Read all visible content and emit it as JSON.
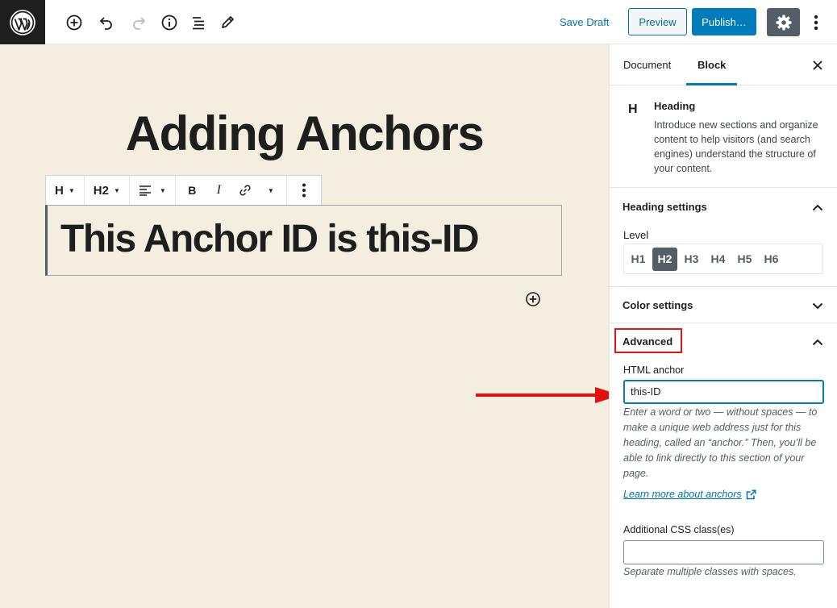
{
  "topbar": {
    "save_draft": "Save Draft",
    "preview": "Preview",
    "publish": "Publish…"
  },
  "editor": {
    "post_title": "Adding Anchors",
    "heading_text": "This Anchor ID is this-ID",
    "block_toolbar": {
      "block_type": "H",
      "heading_level": "H2",
      "bold": "B",
      "italic": "I"
    }
  },
  "sidebar": {
    "tabs": [
      {
        "label": "Document",
        "active": false
      },
      {
        "label": "Block",
        "active": true
      }
    ],
    "block_card": {
      "icon_letter": "H",
      "title": "Heading",
      "description": "Introduce new sections and organize content to help visitors (and search engines) understand the structure of your content."
    },
    "heading_settings": {
      "title": "Heading settings",
      "level_label": "Level",
      "levels": [
        "H1",
        "H2",
        "H3",
        "H4",
        "H5",
        "H6"
      ],
      "selected_level": "H2"
    },
    "color_settings": {
      "title": "Color settings"
    },
    "advanced": {
      "title": "Advanced",
      "anchor_label": "HTML anchor",
      "anchor_value": "this-ID",
      "anchor_help": "Enter a word or two — without spaces — to make a unique web address just for this heading, called an “anchor.” Then, you’ll be able to link directly to this section of your page.",
      "learn_more": "Learn more about anchors",
      "css_label": "Additional CSS class(es)",
      "css_value": "",
      "css_help": "Separate multiple classes with spaces."
    }
  },
  "colors": {
    "canvas_bg": "#f3eedf",
    "accent": "#007cba",
    "highlight_red": "#dc1818",
    "arrow_red": "#e31010"
  }
}
